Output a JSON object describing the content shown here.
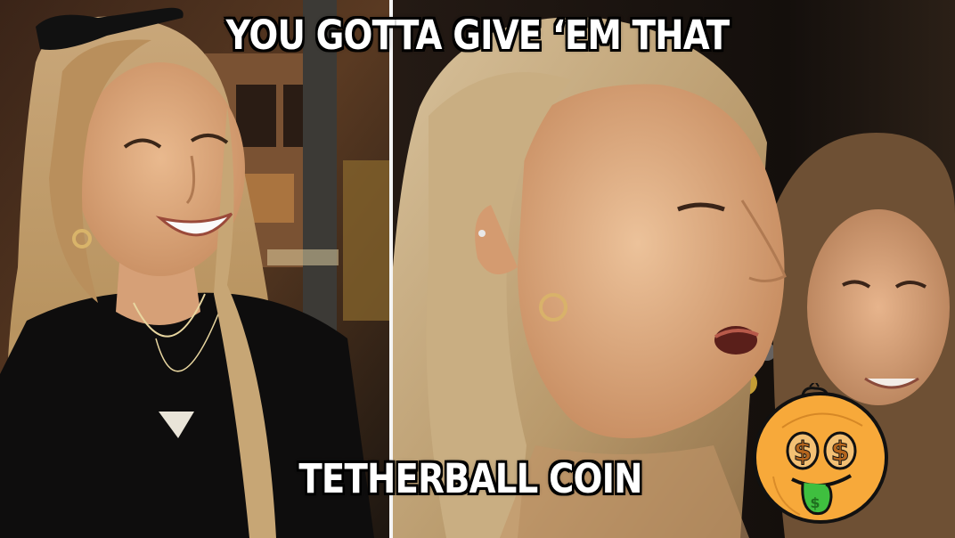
{
  "captions": {
    "top": "YOU GOTTA GIVE ‘EM THAT",
    "bottom": "TETHERBALL COIN"
  },
  "coin_logo": {
    "icon": "dollar-eyes-coin-icon",
    "colors": {
      "face": "#f7a93a",
      "outline": "#111111",
      "tongue": "#3fbf3f",
      "dollar_signs": "#b5651d"
    }
  },
  "colors": {
    "caption_text": "#ffffff",
    "caption_outline": "#000000",
    "divider": "#f4f4f4"
  }
}
